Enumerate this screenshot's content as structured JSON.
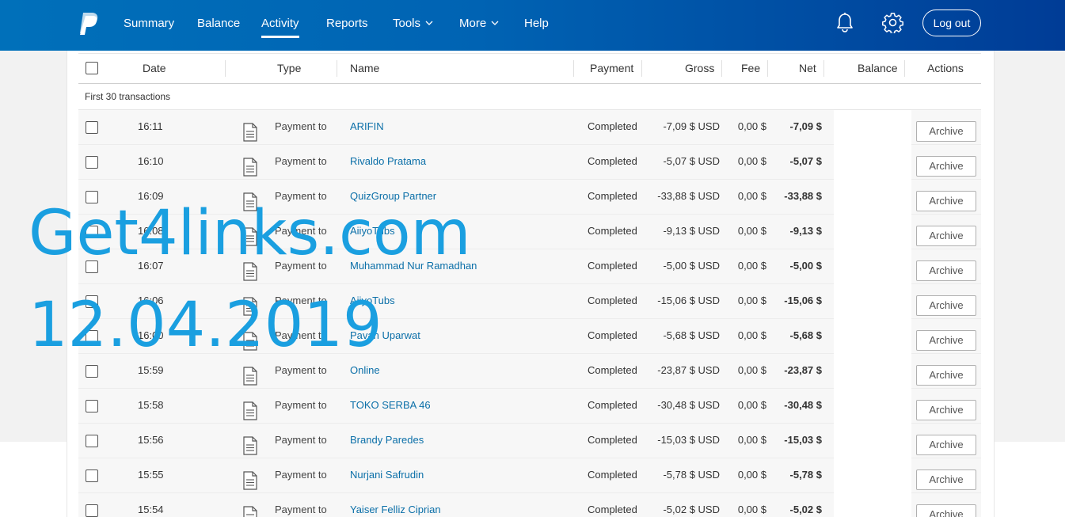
{
  "nav": {
    "items": [
      {
        "label": "Summary",
        "active": false
      },
      {
        "label": "Balance",
        "active": false
      },
      {
        "label": "Activity",
        "active": true
      },
      {
        "label": "Reports",
        "active": false
      },
      {
        "label": "Tools",
        "active": false,
        "dropdown": true
      },
      {
        "label": "More",
        "active": false,
        "dropdown": true
      },
      {
        "label": "Help",
        "active": false
      }
    ],
    "icons": [
      "paypal-logo-icon",
      "bell-icon",
      "gear-icon"
    ],
    "logout_label": "Log out"
  },
  "table": {
    "headers": {
      "date": "Date",
      "type": "Type",
      "name": "Name",
      "payment": "Payment",
      "gross": "Gross",
      "fee": "Fee",
      "net": "Net",
      "balance": "Balance",
      "actions": "Actions"
    },
    "group_label": "First 30 transactions",
    "archive_label": "Archive",
    "rows": [
      {
        "time": "16:11",
        "type": "Payment to",
        "name": "ARIFIN",
        "status": "Completed",
        "gross": "-7,09 $ USD",
        "fee": "0,00 $",
        "net": "-7,09 $"
      },
      {
        "time": "16:10",
        "type": "Payment to",
        "name": "Rivaldo Pratama",
        "status": "Completed",
        "gross": "-5,07 $ USD",
        "fee": "0,00 $",
        "net": "-5,07 $"
      },
      {
        "time": "16:09",
        "type": "Payment to",
        "name": "QuizGroup Partner",
        "status": "Completed",
        "gross": "-33,88 $ USD",
        "fee": "0,00 $",
        "net": "-33,88 $"
      },
      {
        "time": "16:08",
        "type": "Payment to",
        "name": "AiiyoTubs",
        "status": "Completed",
        "gross": "-9,13 $ USD",
        "fee": "0,00 $",
        "net": "-9,13 $"
      },
      {
        "time": "16:07",
        "type": "Payment to",
        "name": "Muhammad Nur Ramadhan",
        "status": "Completed",
        "gross": "-5,00 $ USD",
        "fee": "0,00 $",
        "net": "-5,00 $"
      },
      {
        "time": "16:06",
        "type": "Payment to",
        "name": "AiiyoTubs",
        "status": "Completed",
        "gross": "-15,06 $ USD",
        "fee": "0,00 $",
        "net": "-15,06 $"
      },
      {
        "time": "16:00",
        "type": "Payment to",
        "name": "Pavan Uparwat",
        "status": "Completed",
        "gross": "-5,68 $ USD",
        "fee": "0,00 $",
        "net": "-5,68 $"
      },
      {
        "time": "15:59",
        "type": "Payment to",
        "name": "Online",
        "status": "Completed",
        "gross": "-23,87 $ USD",
        "fee": "0,00 $",
        "net": "-23,87 $"
      },
      {
        "time": "15:58",
        "type": "Payment to",
        "name": "TOKO SERBA 46",
        "status": "Completed",
        "gross": "-30,48 $ USD",
        "fee": "0,00 $",
        "net": "-30,48 $"
      },
      {
        "time": "15:56",
        "type": "Payment to",
        "name": "Brandy Paredes",
        "status": "Completed",
        "gross": "-15,03 $ USD",
        "fee": "0,00 $",
        "net": "-15,03 $"
      },
      {
        "time": "15:55",
        "type": "Payment to",
        "name": "Nurjani Safrudin",
        "status": "Completed",
        "gross": "-5,78 $ USD",
        "fee": "0,00 $",
        "net": "-5,78 $"
      },
      {
        "time": "15:54",
        "type": "Payment to",
        "name": "Yaiser Felliz Ciprian",
        "status": "Completed",
        "gross": "-5,02 $ USD",
        "fee": "0,00 $",
        "net": "-5,02 $"
      }
    ]
  },
  "watermark": {
    "line1": "Get4links.com",
    "line2": "12.04.2019"
  },
  "colors": {
    "nav_start": "#0070ba",
    "nav_end": "#003c96",
    "link": "#0b6fa8",
    "watermark": "#1a9fe0"
  }
}
